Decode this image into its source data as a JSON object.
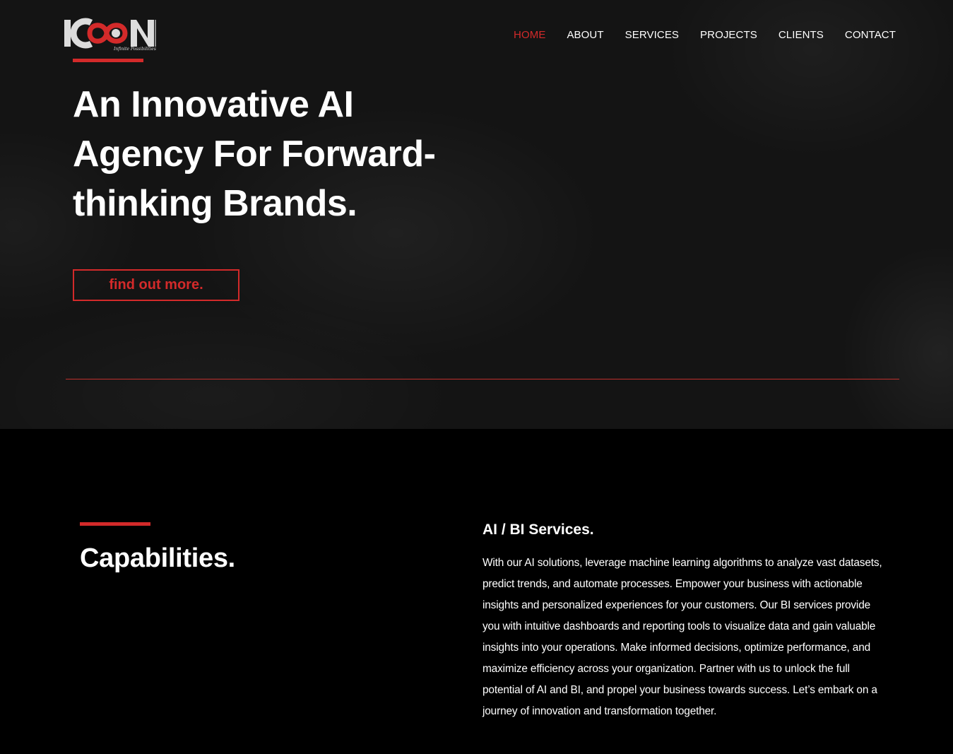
{
  "brand": {
    "logo_text": "ICON",
    "tagline": "Infinite Possibilities",
    "accent_color": "#d32a2a"
  },
  "nav": {
    "items": [
      {
        "label": "HOME",
        "active": true
      },
      {
        "label": "ABOUT",
        "active": false
      },
      {
        "label": "SERVICES",
        "active": false
      },
      {
        "label": "PROJECTS",
        "active": false
      },
      {
        "label": "CLIENTS",
        "active": false
      },
      {
        "label": "CONTACT",
        "active": false
      }
    ]
  },
  "hero": {
    "title_lines": [
      "An Innovative AI",
      "Agency For Forward-",
      "thinking Brands."
    ],
    "cta_label": "find out more."
  },
  "capabilities": {
    "title": "Capabilities.",
    "service_title": "AI / BI Services.",
    "service_body": "With our AI solutions, leverage machine learning algorithms to analyze vast datasets, predict trends, and automate processes. Empower your business with actionable insights and personalized experiences for your customers. Our BI services provide you with intuitive dashboards and reporting tools to visualize data and gain valuable insights into your operations. Make informed decisions, optimize performance, and maximize efficiency across your organization. Partner with us to unlock the full potential of AI and BI, and propel your business towards success. Let’s embark on a journey of innovation and transformation together."
  }
}
